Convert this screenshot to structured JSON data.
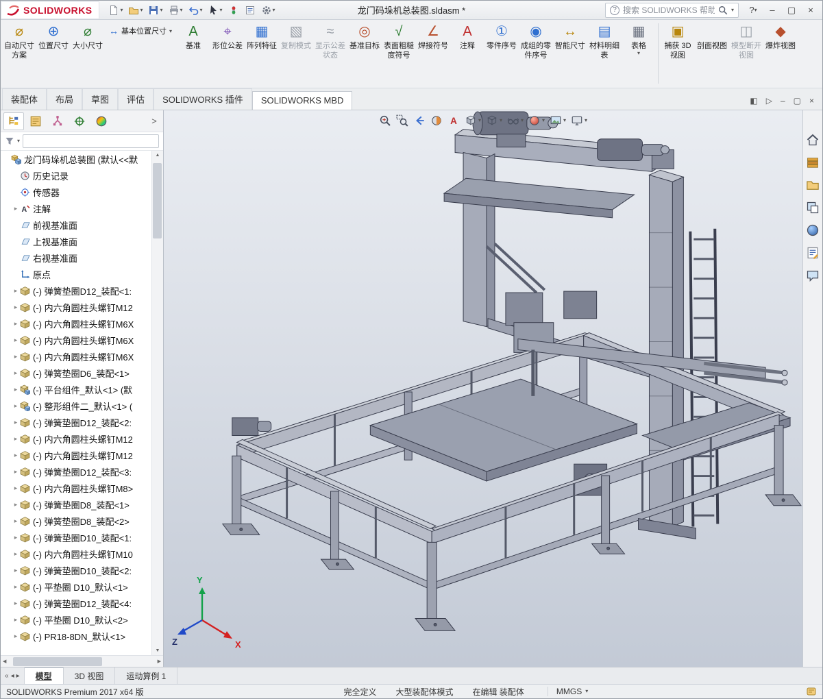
{
  "app": {
    "brand": "SOLIDWORKS",
    "accent_red": "#c8102e",
    "viewport_bg_top": "#eaedf2",
    "viewport_bg_bottom": "#c3cad6"
  },
  "titlebar": {
    "document_title": "龙门码垛机总装图.sldasm *",
    "search_placeholder": "搜索 SOLIDWORKS 帮助",
    "quick_access": [
      {
        "name": "new-document",
        "dropdown": true
      },
      {
        "name": "open",
        "dropdown": true
      },
      {
        "name": "save",
        "dropdown": true
      },
      {
        "name": "print",
        "dropdown": true
      },
      {
        "name": "undo",
        "dropdown": true
      },
      {
        "name": "select",
        "dropdown": true
      },
      {
        "name": "rebuild",
        "dropdown": false
      },
      {
        "name": "file-properties",
        "dropdown": false
      },
      {
        "name": "options",
        "dropdown": true
      }
    ]
  },
  "ribbon": {
    "buttons": [
      {
        "label": "自动尺寸方案",
        "icon": "auto-dimension-scheme"
      },
      {
        "label": "位置尺寸",
        "icon": "location-dimension"
      },
      {
        "label": "大小尺寸",
        "icon": "size-dimension"
      },
      {
        "label": "基本位置尺寸",
        "icon": "basic-location-dimension",
        "inline": true,
        "dropdown": true
      },
      {
        "label": "基准",
        "icon": "datum"
      },
      {
        "label": "形位公差",
        "icon": "geometric-tolerance"
      },
      {
        "label": "阵列特征",
        "icon": "pattern-feature"
      },
      {
        "label": "复制模式",
        "icon": "copy-scheme",
        "disabled": true
      },
      {
        "label": "显示公差状态",
        "icon": "tolerance-status",
        "disabled": true
      },
      {
        "label": "基准目标",
        "icon": "datum-target"
      },
      {
        "label": "表面粗糙度符号",
        "icon": "surface-finish"
      },
      {
        "label": "焊接符号",
        "icon": "weld-symbol"
      },
      {
        "label": "注释",
        "icon": "note"
      },
      {
        "label": "零件序号",
        "icon": "balloon"
      },
      {
        "label": "成组的零件序号",
        "icon": "auto-balloon"
      },
      {
        "label": "智能尺寸",
        "icon": "smart-dimension"
      },
      {
        "label": "材料明细表",
        "icon": "bill-of-materials"
      },
      {
        "label": "表格",
        "icon": "tables",
        "dropdown": true
      },
      {
        "label": "捕获 3D 视图",
        "icon": "capture-3d-view",
        "separator_before": true
      },
      {
        "label": "剖面视图",
        "icon": "section-view"
      },
      {
        "label": "模型断开视图",
        "icon": "model-break-view",
        "disabled": true
      },
      {
        "label": "爆炸视图",
        "icon": "exploded-view"
      }
    ]
  },
  "command_tabs": {
    "items": [
      {
        "label": "装配体"
      },
      {
        "label": "布局"
      },
      {
        "label": "草图"
      },
      {
        "label": "评估"
      },
      {
        "label": "SOLIDWORKS 插件"
      },
      {
        "label": "SOLIDWORKS MBD",
        "active": true
      }
    ]
  },
  "feature_panel": {
    "toolbar": [
      "featuremanager",
      "propertymanager",
      "configurationmanager",
      "dimxpertmanager",
      "displaymanager"
    ],
    "tree": {
      "root": {
        "label": "龙门码垛机总装图 (默认<<默",
        "icon": "assembly"
      },
      "items": [
        {
          "label": "历史记录",
          "icon": "history"
        },
        {
          "label": "传感器",
          "icon": "sensors"
        },
        {
          "label": "注解",
          "icon": "annotations",
          "expander": true
        },
        {
          "label": "前视基准面",
          "icon": "plane"
        },
        {
          "label": "上视基准面",
          "icon": "plane"
        },
        {
          "label": "右视基准面",
          "icon": "plane"
        },
        {
          "label": "原点",
          "icon": "origin"
        },
        {
          "label": "(-) 弹簧垫圈D12_装配<1:",
          "icon": "part",
          "expander": true
        },
        {
          "label": "(-) 内六角圆柱头螺钉M12",
          "icon": "part",
          "expander": true
        },
        {
          "label": "(-) 内六角圆柱头螺钉M6X",
          "icon": "part",
          "expander": true
        },
        {
          "label": "(-) 内六角圆柱头螺钉M6X",
          "icon": "part",
          "expander": true
        },
        {
          "label": "(-) 内六角圆柱头螺钉M6X",
          "icon": "part",
          "expander": true
        },
        {
          "label": "(-) 弹簧垫圈D6_装配<1>",
          "icon": "part",
          "expander": true
        },
        {
          "label": "(-) 平台组件_默认<1> (默",
          "icon": "subassembly",
          "expander": true
        },
        {
          "label": "(-) 整形组件二_默认<1> (",
          "icon": "subassembly",
          "expander": true
        },
        {
          "label": "(-) 弹簧垫圈D12_装配<2:",
          "icon": "part",
          "expander": true
        },
        {
          "label": "(-) 内六角圆柱头螺钉M12",
          "icon": "part",
          "expander": true
        },
        {
          "label": "(-) 内六角圆柱头螺钉M12",
          "icon": "part",
          "expander": true
        },
        {
          "label": "(-) 弹簧垫圈D12_装配<3:",
          "icon": "part",
          "expander": true
        },
        {
          "label": "(-) 内六角圆柱头螺钉M8>",
          "icon": "part",
          "expander": true
        },
        {
          "label": "(-) 弹簧垫圈D8_装配<1>",
          "icon": "part",
          "expander": true
        },
        {
          "label": "(-) 弹簧垫圈D8_装配<2>",
          "icon": "part",
          "expander": true
        },
        {
          "label": "(-) 弹簧垫圈D10_装配<1:",
          "icon": "part",
          "expander": true
        },
        {
          "label": "(-) 内六角圆柱头螺钉M10",
          "icon": "part",
          "expander": true
        },
        {
          "label": "(-) 弹簧垫圈D10_装配<2:",
          "icon": "part",
          "expander": true
        },
        {
          "label": "(-) 平垫圈 D10_默认<1>",
          "icon": "part",
          "expander": true
        },
        {
          "label": "(-) 弹簧垫圈D12_装配<4:",
          "icon": "part",
          "expander": true
        },
        {
          "label": "(-) 平垫圈 D10_默认<2>",
          "icon": "part",
          "expander": true
        },
        {
          "label": "(-) PR18-8DN_默认<1>",
          "icon": "part",
          "expander": true
        }
      ]
    }
  },
  "viewport": {
    "hud": [
      {
        "name": "zoom-fit"
      },
      {
        "name": "zoom-area"
      },
      {
        "name": "previous-view"
      },
      {
        "name": "section-view"
      },
      {
        "name": "annotation-visibility"
      },
      {
        "name": "view-orientation",
        "dropdown": true
      },
      {
        "name": "display-style",
        "dropdown": true
      },
      {
        "name": "hide-show-items",
        "dropdown": true
      },
      {
        "name": "edit-appearance",
        "dropdown": true
      },
      {
        "name": "apply-scene",
        "dropdown": true
      },
      {
        "name": "view-settings",
        "dropdown": true
      }
    ],
    "triad": {
      "x": "X",
      "y": "Y",
      "z": "Z"
    }
  },
  "task_pane": [
    "home",
    "design-library",
    "file-explorer",
    "view-palette",
    "appearances",
    "custom-properties",
    "solidworks-forum"
  ],
  "model_tabs": {
    "items": [
      {
        "label": "模型",
        "active": true
      },
      {
        "label": "3D 视图"
      },
      {
        "label": "运动算例 1"
      }
    ]
  },
  "statusbar": {
    "product": "SOLIDWORKS Premium 2017 x64 版",
    "fields": [
      "完全定义",
      "大型装配体模式",
      "在编辑 装配体"
    ],
    "units": "MMGS"
  }
}
